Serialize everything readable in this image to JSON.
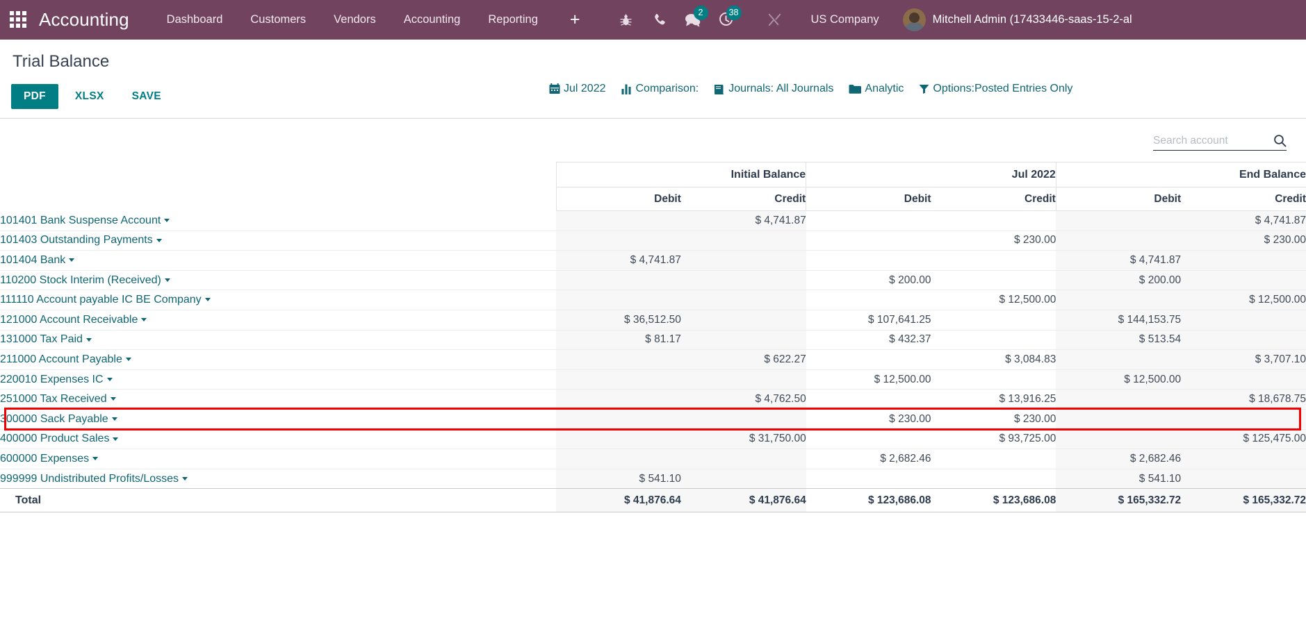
{
  "navbar": {
    "apps_icon": "apps-grid-icon",
    "brand": "Accounting",
    "menu": [
      {
        "label": "Dashboard",
        "name": "nav-dashboard"
      },
      {
        "label": "Customers",
        "name": "nav-customers"
      },
      {
        "label": "Vendors",
        "name": "nav-vendors"
      },
      {
        "label": "Accounting",
        "name": "nav-accounting"
      },
      {
        "label": "Reporting",
        "name": "nav-reporting"
      }
    ],
    "plus_label": "+",
    "sys_icons": [
      {
        "name": "bug-icon",
        "badge": null
      },
      {
        "name": "phone-icon",
        "badge": null
      },
      {
        "name": "messages-icon",
        "badge": "2"
      },
      {
        "name": "activities-icon",
        "badge": "38"
      },
      {
        "name": "tools-icon",
        "badge": null
      }
    ],
    "company": "US Company",
    "user": "Mitchell Admin (17433446-saas-15-2-al",
    "accent_badge": "#017e84",
    "bar_color": "#71435f"
  },
  "control": {
    "title": "Trial Balance",
    "buttons": [
      {
        "label": "PDF",
        "name": "pdf-button",
        "primary": true
      },
      {
        "label": "XLSX",
        "name": "xlsx-button",
        "primary": false
      },
      {
        "label": "SAVE",
        "name": "save-button",
        "primary": false
      }
    ],
    "filters": [
      {
        "label": "Jul 2022",
        "icon": "calendar-icon",
        "name": "date-filter"
      },
      {
        "label": "Comparison:",
        "icon": "bar-chart-icon",
        "name": "comparison-filter"
      },
      {
        "label": "Journals: All Journals",
        "icon": "book-icon",
        "name": "journals-filter"
      },
      {
        "label": "Analytic",
        "icon": "folder-icon",
        "name": "analytic-filter"
      },
      {
        "label": "Options:Posted Entries Only",
        "icon": "funnel-icon",
        "name": "options-filter"
      }
    ]
  },
  "search": {
    "placeholder": "Search account",
    "value": "",
    "icon": "search-icon"
  },
  "table": {
    "group_headers": [
      "Initial Balance",
      "Jul 2022",
      "End Balance"
    ],
    "sub_headers": [
      "Debit",
      "Credit",
      "Debit",
      "Credit",
      "Debit",
      "Credit"
    ],
    "rows": [
      {
        "account": "101401 Bank Suspense Account",
        "cells": [
          "",
          "$ 4,741.87",
          "",
          "",
          "",
          "$ 4,741.87"
        ]
      },
      {
        "account": "101403 Outstanding Payments",
        "cells": [
          "",
          "",
          "",
          "$ 230.00",
          "",
          "$ 230.00"
        ]
      },
      {
        "account": "101404 Bank",
        "cells": [
          "$ 4,741.87",
          "",
          "",
          "",
          "$ 4,741.87",
          ""
        ]
      },
      {
        "account": "110200 Stock Interim (Received)",
        "cells": [
          "",
          "",
          "$ 200.00",
          "",
          "$ 200.00",
          ""
        ]
      },
      {
        "account": "111110 Account payable IC BE Company",
        "cells": [
          "",
          "",
          "",
          "$ 12,500.00",
          "",
          "$ 12,500.00"
        ]
      },
      {
        "account": "121000 Account Receivable",
        "cells": [
          "$ 36,512.50",
          "",
          "$ 107,641.25",
          "",
          "$ 144,153.75",
          ""
        ]
      },
      {
        "account": "131000 Tax Paid",
        "cells": [
          "$ 81.17",
          "",
          "$ 432.37",
          "",
          "$ 513.54",
          ""
        ]
      },
      {
        "account": "211000 Account Payable",
        "cells": [
          "",
          "$ 622.27",
          "",
          "$ 3,084.83",
          "",
          "$ 3,707.10"
        ]
      },
      {
        "account": "220010 Expenses IC",
        "cells": [
          "",
          "",
          "$ 12,500.00",
          "",
          "$ 12,500.00",
          ""
        ]
      },
      {
        "account": "251000 Tax Received",
        "cells": [
          "",
          "$ 4,762.50",
          "",
          "$ 13,916.25",
          "",
          "$ 18,678.75"
        ]
      },
      {
        "account": "300000 Sack Payable",
        "cells": [
          "",
          "",
          "$ 230.00",
          "$ 230.00",
          "",
          ""
        ],
        "highlighted": true
      },
      {
        "account": "400000 Product Sales",
        "cells": [
          "",
          "$ 31,750.00",
          "",
          "$ 93,725.00",
          "",
          "$ 125,475.00"
        ]
      },
      {
        "account": "600000 Expenses",
        "cells": [
          "",
          "",
          "$ 2,682.46",
          "",
          "$ 2,682.46",
          ""
        ]
      },
      {
        "account": "999999 Undistributed Profits/Losses",
        "cells": [
          "$ 541.10",
          "",
          "",
          "",
          "$ 541.10",
          ""
        ]
      }
    ],
    "total": {
      "label": "Total",
      "cells": [
        "$ 41,876.64",
        "$ 41,876.64",
        "$ 123,686.08",
        "$ 123,686.08",
        "$ 165,332.72",
        "$ 165,332.72"
      ]
    },
    "highlight_color": "#f50000",
    "link_color": "#0f6674"
  }
}
